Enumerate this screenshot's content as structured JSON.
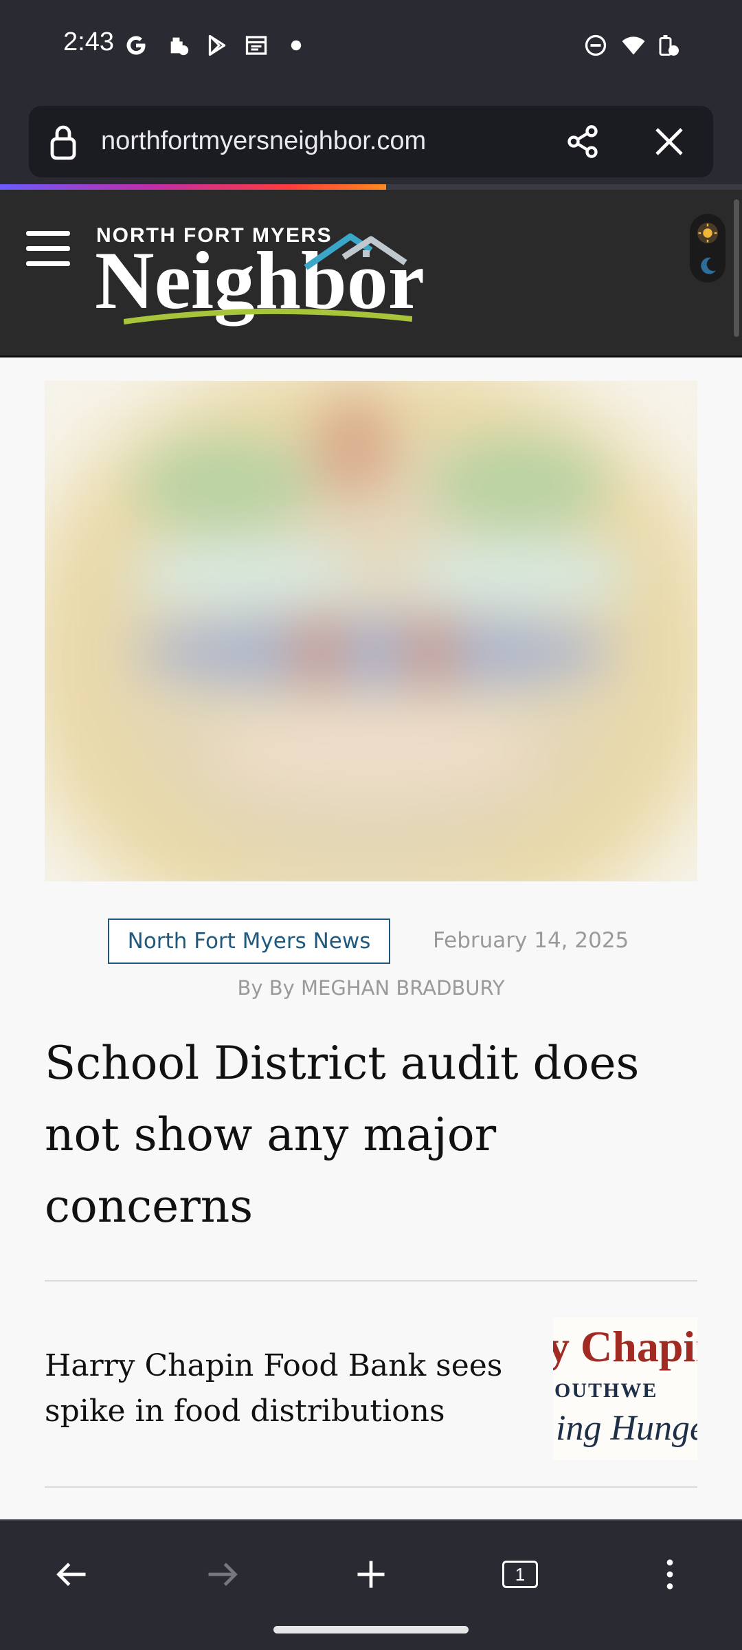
{
  "status_bar": {
    "time": "2:43",
    "left_icons": [
      "google-icon",
      "work-profile-icon",
      "play-store-icon",
      "calendar-icon",
      "notification-dot-icon"
    ],
    "right_icons": [
      "do-not-disturb-icon",
      "wifi-icon",
      "battery-icon"
    ]
  },
  "browser": {
    "url": "northfortmyersneighbor.com",
    "icons": [
      "lock-icon",
      "share-icon",
      "close-icon"
    ],
    "load_progress": 0.52
  },
  "site": {
    "logo_small": "NORTH FORT MYERS",
    "logo_big": "Neighbor",
    "theme_icons": [
      "sun-icon",
      "moon-icon"
    ]
  },
  "article": {
    "category": "North Fort Myers News",
    "date": "February 14, 2025",
    "byline": "By By MEGHAN BRADBURY",
    "headline": "School District audit does not show any major concerns"
  },
  "related": {
    "title": "Harry Chapin Food Bank sees spike in food distributions",
    "thumbnail_text": {
      "line1": "y Chapin",
      "line2": "OUTHWE",
      "line3": "ing Hunge"
    }
  },
  "bottom_nav": {
    "tab_count": "1",
    "icons": [
      "back-arrow-icon",
      "forward-arrow-icon",
      "new-tab-icon",
      "tab-switcher-icon",
      "more-options-icon"
    ]
  },
  "colors": {
    "accent_link": "#1f5a7e",
    "header_bg": "#2a2a2a",
    "chrome_bg": "#2a2a33"
  }
}
